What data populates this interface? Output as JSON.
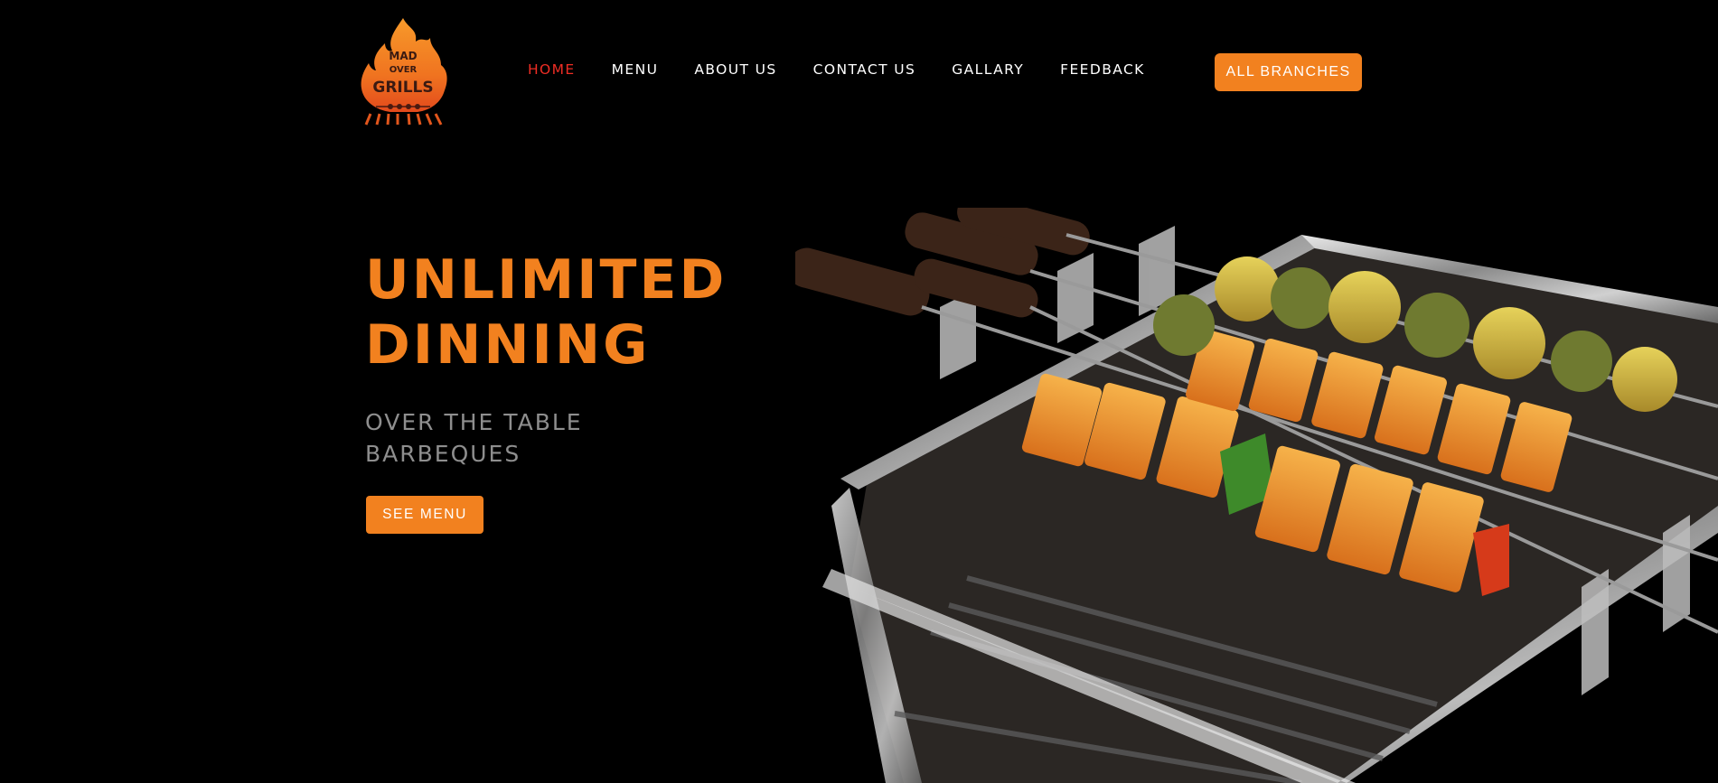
{
  "header": {
    "logo": {
      "lines": [
        "MAD",
        "OVER",
        "GRILLS"
      ],
      "icon": "flame-logo-icon"
    },
    "nav": [
      {
        "label": "HOME",
        "active": true
      },
      {
        "label": "MENU",
        "active": false
      },
      {
        "label": "ABOUT US",
        "active": false
      },
      {
        "label": "CONTACT US",
        "active": false
      },
      {
        "label": "GALLARY",
        "active": false
      },
      {
        "label": "FEEDBACK",
        "active": false
      }
    ],
    "branches_label": "ALL BRANCHES"
  },
  "hero": {
    "title": "UNLIMITED\nDINNING",
    "subtitle": "OVER THE TABLE\nBARBEQUES",
    "cta_label": "SEE MENU",
    "image_icon": "grill-skewers-photo"
  },
  "colors": {
    "accent": "#f2811f",
    "active_nav": "#ee2d24",
    "background": "#000000",
    "subtitle": "#8e8e8e"
  }
}
